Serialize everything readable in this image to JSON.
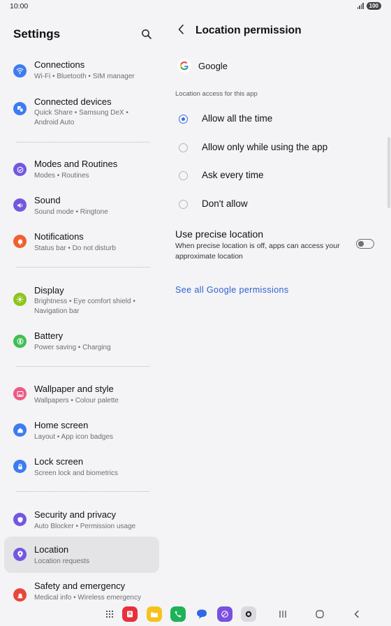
{
  "status": {
    "time": "10:00",
    "battery": "100"
  },
  "left": {
    "title": "Settings",
    "items": [
      {
        "title": "Connections",
        "sub": "Wi-Fi  •  Bluetooth  •  SIM manager",
        "icon": "wifi-icon",
        "color": "#3d7cf0"
      },
      {
        "title": "Connected devices",
        "sub": "Quick Share  •  Samsung DeX  •  Android Auto",
        "icon": "connected-devices-icon",
        "color": "#3d7cf0"
      },
      {
        "title": "Modes and Routines",
        "sub": "Modes  •  Routines",
        "icon": "modes-routines-icon",
        "color": "#7357e0"
      },
      {
        "title": "Sound",
        "sub": "Sound mode  •  Ringtone",
        "icon": "sound-icon",
        "color": "#7357e0"
      },
      {
        "title": "Notifications",
        "sub": "Status bar  •  Do not disturb",
        "icon": "bell-icon",
        "color": "#f0612e"
      },
      {
        "title": "Display",
        "sub": "Brightness  •  Eye comfort shield  •  Navigation bar",
        "icon": "sun-icon",
        "color": "#8cc41c"
      },
      {
        "title": "Battery",
        "sub": "Power saving  •  Charging",
        "icon": "battery-icon",
        "color": "#3fbf55"
      },
      {
        "title": "Wallpaper and style",
        "sub": "Wallpapers  •  Colour palette",
        "icon": "wallpaper-icon",
        "color": "#ec5b84"
      },
      {
        "title": "Home screen",
        "sub": "Layout  •  App icon badges",
        "icon": "home-icon",
        "color": "#3d7cf0"
      },
      {
        "title": "Lock screen",
        "sub": "Screen lock and biometrics",
        "icon": "lock-icon",
        "color": "#3d7cf0"
      },
      {
        "title": "Security and privacy",
        "sub": "Auto Blocker  •  Permission usage",
        "icon": "shield-icon",
        "color": "#7357e0"
      },
      {
        "title": "Location",
        "sub": "Location requests",
        "icon": "location-pin-icon",
        "color": "#7357e0"
      },
      {
        "title": "Safety and emergency",
        "sub": "Medical info  •  Wireless emergency",
        "icon": "emergency-icon",
        "color": "#e8473a"
      }
    ],
    "selected": "Location"
  },
  "right": {
    "title": "Location permission",
    "app_name": "Google",
    "section_label": "Location access for this app",
    "options": [
      {
        "label": "Allow all the time",
        "checked": true
      },
      {
        "label": "Allow only while using the app",
        "checked": false
      },
      {
        "label": "Ask every time",
        "checked": false
      },
      {
        "label": "Don't allow",
        "checked": false
      }
    ],
    "precise": {
      "title": "Use precise location",
      "desc": "When precise location is off, apps can access your approximate location",
      "enabled": false
    },
    "link": "See all Google permissions"
  },
  "colors": {
    "accent": "#3e6fe6",
    "link": "#2e5fd0",
    "background": "#f4f4f6"
  }
}
